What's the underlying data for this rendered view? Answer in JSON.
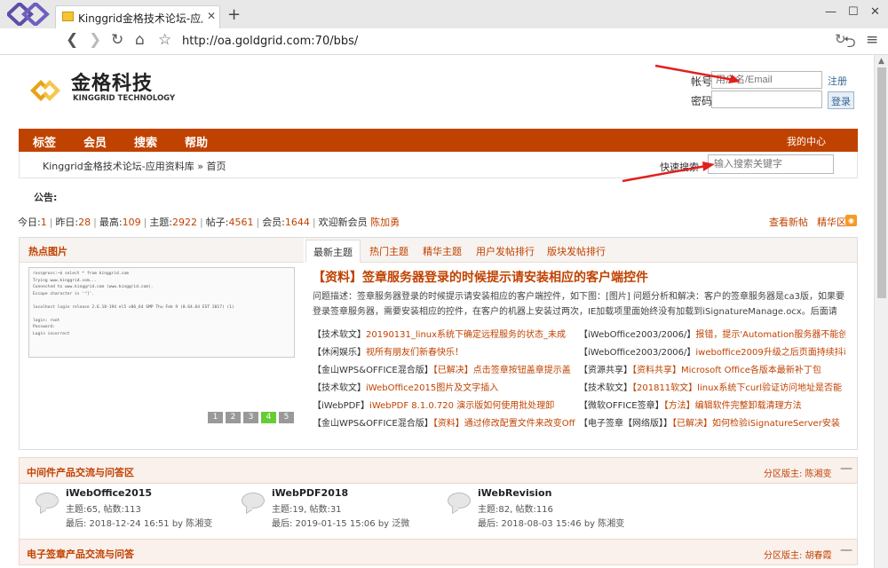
{
  "browser": {
    "tab_title": "Kinggrid金格技术论坛-应用资料库",
    "tab_close": "✕",
    "new_tab": "+",
    "url": "http://oa.goldgrid.com:70/bbs/",
    "back": "❮",
    "forward": "❯",
    "reload": "↻",
    "home": "⌂",
    "star": "☆",
    "undo": "⮌",
    "menu": "≡",
    "min": "—",
    "max": "☐",
    "close": "✕",
    "icons": [
      "browser-logo-icon",
      "favicon-icon",
      "back-icon",
      "forward-icon",
      "reload-icon",
      "home-icon",
      "star-icon",
      "undo-icon",
      "menu-icon"
    ]
  },
  "site": {
    "logo_cn": "金格科技",
    "logo_en": "KINGGRID TECHNOLOGY",
    "account_label": "帐号",
    "account_placeholder": "用户名/Email",
    "register_link": "注册",
    "password_label": "密码",
    "login_button": "登录",
    "accent_color": "#c04200"
  },
  "nav": {
    "items": [
      "标签",
      "会员",
      "搜索",
      "帮助"
    ],
    "my_center": "我的中心"
  },
  "breadcrumb": {
    "forum_name": "Kinggrid金格技术论坛-应用资料库",
    "separator": "»",
    "current": "首页"
  },
  "quick_search": {
    "label": "快速搜索",
    "placeholder": "输入搜索关键字"
  },
  "notice": {
    "label": "公告:"
  },
  "stats": {
    "today_label": "今日:",
    "today": "1",
    "yesterday_label": "昨日:",
    "yesterday": "28",
    "max_label": "最高:",
    "max": "109",
    "topics_label": "主题:",
    "topics": "2922",
    "posts_label": "帖子:",
    "posts": "4561",
    "members_label": "会员:",
    "members": "1644",
    "welcome_label": "欢迎新会员",
    "newest_member": "陈加勇",
    "view_new": "查看新帖",
    "digest": "精华区",
    "separator": "|"
  },
  "hot_images": {
    "title": "热点图片",
    "terminal_lines": [
      "ross@ross:~$ select * from kinggrid.com",
      "Trying www.kinggrid.com...",
      "Connected to www.kinggrid.com (www.kinggrid.com).",
      "Escape character is '^]'.",
      "",
      "    localhost login release 2.6.18-194 el5 x86_64 SMP Thu Feb 9 (0.64.64 EST 2017) (1)",
      "",
      "login: root",
      "Password:",
      "Login incorrect"
    ],
    "pages": [
      "1",
      "2",
      "3",
      "4",
      "5"
    ],
    "active_page": 3
  },
  "forum_tabs": [
    "最新主题",
    "热门主题",
    "精华主题",
    "用户发帖排行",
    "版块发帖排行"
  ],
  "featured": {
    "title": "【资料】签章服务器登录的时候提示请安装相应的客户端控件",
    "description": "问题描述：签章服务器登录的时候提示请安装相应的客户端控件，如下图：[图片] 问题分析和解决：客户的签章服务器是ca3版，如果要登录签章服务器，需要安装相应的控件，在客户的机器上安装过两次，IE加载项里面始终没有加载到iSignatureManage.ocx。后面请研发"
  },
  "posts_left": [
    {
      "cat": "【技术软文】",
      "title": "20190131_linux系统下确定远程服务的状态_未成"
    },
    {
      "cat": "【休闲娱乐】",
      "title": "视所有朋友们新春快乐！"
    },
    {
      "cat": "【金山WPS&OFFICE混合版】",
      "title": "【已解决】点击签章按钮盖章提示盖"
    },
    {
      "cat": "【技术软文】",
      "title": "iWebOffice2015图片及文字插入"
    },
    {
      "cat": "【iWebPDF】",
      "title": "iWebPDF 8.1.0.720 演示版如何使用批处理卸"
    },
    {
      "cat": "【金山WPS&OFFICE混合版】",
      "title": "【资料】通过修改配置文件来改变Off"
    }
  ],
  "posts_right": [
    {
      "cat": "【iWebOffice2003/2006/】",
      "title": "报错，提示'Automation服务器不能创建"
    },
    {
      "cat": "【iWebOffice2003/2006/】",
      "title": "iweboffice2009升级之后页面持续抖动问"
    },
    {
      "cat": "【资源共享】",
      "title": "【资料共享】Microsoft Office各版本最新补丁包"
    },
    {
      "cat": "【技术软文】",
      "title": "【201811软文】linux系统下curl验证访问地址是否能"
    },
    {
      "cat": "【微软OFFICE签章】",
      "title": "【方法】编辑软件完整卸载清理方法"
    },
    {
      "cat": "【电子签章【网络版】】",
      "title": "【已解决】如何检验iSignatureServer安装"
    }
  ],
  "sections": [
    {
      "title": "中间件产品交流与问答区",
      "moderator_label": "分区版主:",
      "moderator": "陈湘变",
      "collapse": "—",
      "forums": [
        {
          "name": "iWebOffice2015",
          "count": "主题:65, 帖数:113",
          "last": "最后: 2018-12-24 16:51 by 陈湘变"
        },
        {
          "name": "iWebPDF2018",
          "count": "主题:19, 帖数:31",
          "last": "最后: 2019-01-15 15:06 by 泛微"
        },
        {
          "name": "iWebRevision",
          "count": "主题:82, 帖数:116",
          "last": "最后: 2018-08-03 15:46 by 陈湘变"
        }
      ]
    },
    {
      "title": "电子签章产品交流与问答",
      "moderator_label": "分区版主:",
      "moderator": "胡春霞",
      "collapse": "—"
    }
  ]
}
